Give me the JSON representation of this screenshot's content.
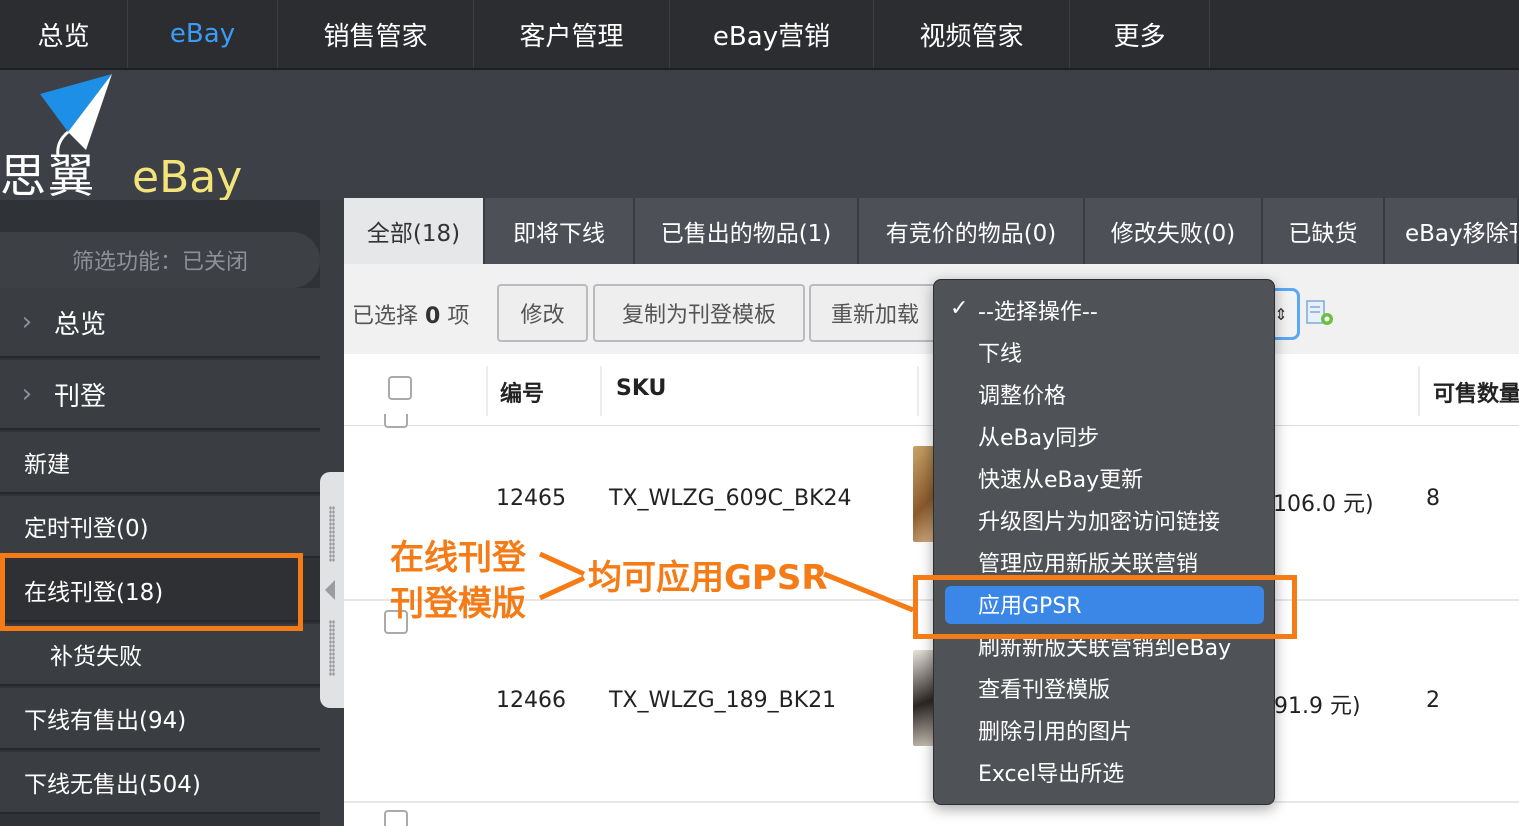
{
  "top_nav": {
    "items": [
      "总览",
      "eBay",
      "销售管家",
      "客户管理",
      "eBay营销",
      "视频管家",
      "更多"
    ],
    "active_index": 1
  },
  "logo": {
    "cn": "思翼",
    "en": "eBay"
  },
  "sidebar": {
    "filter_label": "筛选功能：已关闭",
    "sections": [
      "总览",
      "刊登"
    ],
    "items": [
      "新建",
      "定时刊登(0)",
      "在线刊登(18)",
      "补货失败",
      "下线有售出(94)",
      "下线无售出(504)"
    ],
    "active_item": "在线刊登(18)"
  },
  "tabs": [
    "全部(18)",
    "即将下线",
    "已售出的物品(1)",
    "有竞价的物品(0)",
    "修改失败(0)",
    "已缺货",
    "eBay移除刊"
  ],
  "toolbar": {
    "selected_prefix": "已选择",
    "selected_count": "0",
    "selected_suffix": "项",
    "buttons": [
      "修改",
      "复制为刊登模板",
      "重新加载"
    ]
  },
  "table": {
    "headers": [
      "编号",
      "SKU",
      "可售数量"
    ],
    "rows": [
      {
        "id": "12465",
        "sku": "TX_WLZG_609C_BK24",
        "price_partial": "106.0 元)",
        "qty": "8"
      },
      {
        "id": "12466",
        "sku": "TX_WLZG_189_BK21",
        "price_partial": "91.9 元)",
        "qty": "2"
      }
    ]
  },
  "dropdown": {
    "selected_label": "--选择操作--",
    "options": [
      "下线",
      "调整价格",
      "从eBay同步",
      "快速从eBay更新",
      "升级图片为加密访问链接",
      "管理应用新版关联营销",
      "应用GPSR",
      "刷新新版关联营销到eBay",
      "查看刊登模版",
      "删除引用的图片",
      "Excel导出所选"
    ],
    "highlighted_option": "应用GPSR"
  },
  "annotations": {
    "left_lines": [
      "在线刊登",
      "刊登模版"
    ],
    "right_text": "均可应用GPSR"
  },
  "colors": {
    "accent_orange": "#f57b16",
    "active_blue": "#3b9cf5",
    "highlight_blue": "#3b87e8"
  }
}
